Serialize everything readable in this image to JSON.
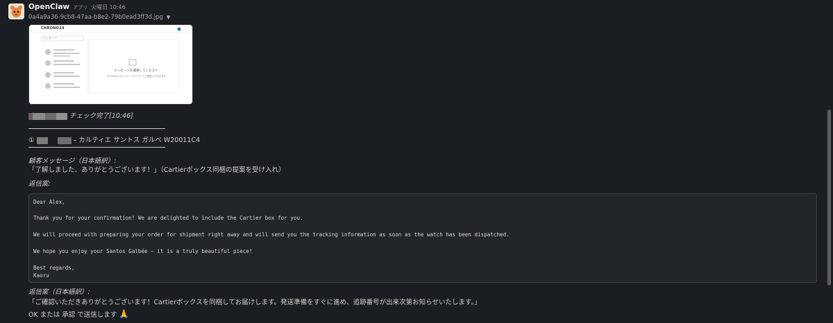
{
  "message": {
    "sender": "OpenClaw",
    "app_badge": "アプリ",
    "time": "火曜日 10:46",
    "file_name": "0a4a9a36-9cb8-47aa-b8e2-79b0ead3ff3d.jpg",
    "thumbnail": {
      "logo": "CHRONO24",
      "search_placeholder": "メッセージ",
      "empty_title": "メッセージを選択してください",
      "empty_sub": "Chrono24 のメッセージセンターでご確認いただけます"
    },
    "check_label": "チェック完了",
    "check_time": "[10:46]",
    "item_number": "①",
    "item_title": "– カルティエ サントス ガルベ W20011C4",
    "customer_msg_label": "顧客メッセージ（日本語訳）:",
    "customer_msg": "「了解しました、ありがとうございます！」（Cartierボックス同梱の提案を受け入れ）",
    "reply_label": "返信案:",
    "reply_lines": [
      "Dear Alex,",
      "Thank you for your confirmation! We are delighted to include the Cartier box for you.",
      "We will proceed with preparing your order for shipment right away and will send you the tracking information as soon as the watch has been dispatched.",
      "We hope you enjoy your Santos Galbée – it is a truly beautiful piece!",
      "Best regards,",
      "Kaoru"
    ],
    "reply_jp_label": "返信案（日本語訳）:",
    "reply_jp": "「ご確認いただきありがとうございます！Cartierボックスを同梱してお届けします。発送準備をすぐに進め、追跡番号が出来次第お知らせいたします。」",
    "footer_text": "OK または 承認 で送信します",
    "footer_emoji": "🙏"
  },
  "colors": {
    "background": "#1a1d21",
    "text": "#d1d2d3",
    "code_bg": "#222529"
  }
}
